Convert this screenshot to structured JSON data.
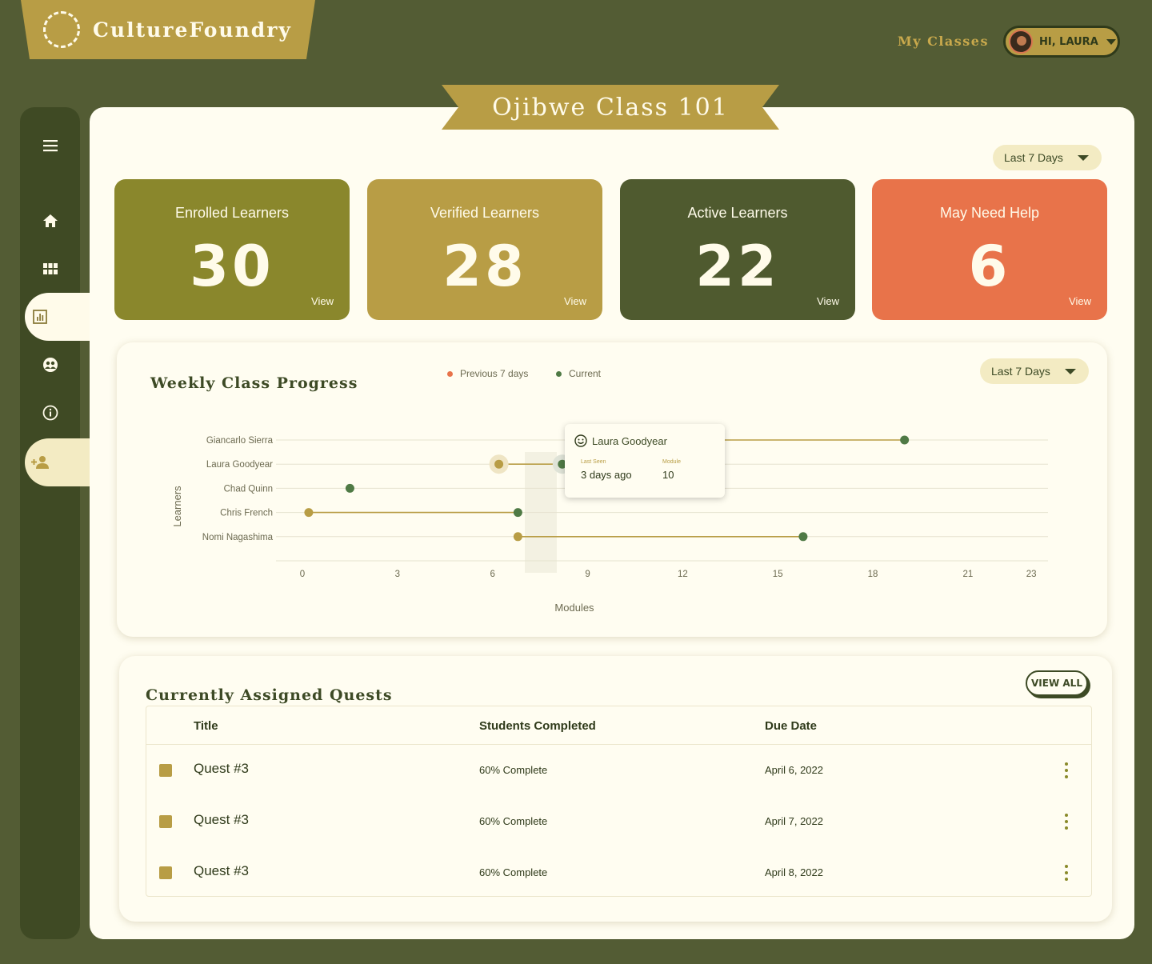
{
  "header": {
    "logo_text": "CultureFoundry",
    "my_classes": "My Classes",
    "user_greeting": "HI, LAURA"
  },
  "page": {
    "class_title": "Ojibwe Class 101",
    "date_filter": "Last 7 Days"
  },
  "sidebar": {
    "items": [
      {
        "name": "menu",
        "icon": "menu-icon"
      },
      {
        "name": "home",
        "icon": "home-icon"
      },
      {
        "name": "dashboard",
        "icon": "grid-icon"
      },
      {
        "name": "analytics",
        "icon": "chart-icon",
        "active": true
      },
      {
        "name": "community",
        "icon": "group-icon"
      },
      {
        "name": "info",
        "icon": "info-icon"
      },
      {
        "name": "add-learner",
        "icon": "add-user-icon"
      }
    ]
  },
  "stats": [
    {
      "label": "Enrolled Learners",
      "value": "30",
      "view": "View",
      "color": "#8a872c"
    },
    {
      "label": "Verified Learners",
      "value": "28",
      "view": "View",
      "color": "#b89d45"
    },
    {
      "label": "Active Learners",
      "value": "22",
      "view": "View",
      "color": "#4f5a2f"
    },
    {
      "label": "May Need Help",
      "value": "6",
      "view": "View",
      "color": "#e8734a"
    }
  ],
  "progress": {
    "title": "Weekly Class Progress",
    "date_filter": "Last 7 Days",
    "legend_previous": "Previous 7 days",
    "legend_current": "Current",
    "tooltip": {
      "name": "Laura Goodyear",
      "last_seen_label": "Last Seen",
      "last_seen_value": "3 days ago",
      "module_label": "Module",
      "module_value": "10"
    }
  },
  "chart_data": {
    "type": "dumbbell",
    "xlabel": "Modules",
    "ylabel": "Learners",
    "xlim": [
      0,
      24
    ],
    "x_ticks": [
      "0",
      "3",
      "6",
      "9",
      "12",
      "15",
      "18",
      "21",
      "23"
    ],
    "categories": [
      "Giancarlo Sierra",
      "Laura Goodyear",
      "Chad Quinn",
      "Chris French",
      "Nomi Nagashima"
    ],
    "series": [
      {
        "name": "Previous 7 days",
        "color": "#b89d45",
        "values": [
          8.5,
          6.2,
          1.5,
          0.2,
          6.8
        ]
      },
      {
        "name": "Current",
        "color": "#4f7a45",
        "values": [
          19,
          8.2,
          1.5,
          6.8,
          15.8
        ]
      }
    ],
    "legend_dot_colors": {
      "previous": "#e8734a",
      "current": "#4f7a45"
    }
  },
  "quests": {
    "title": "Currently Assigned Quests",
    "view_all": "VIEW ALL",
    "columns": [
      "Title",
      "Students Completed",
      "Due Date"
    ],
    "rows": [
      {
        "title": "Quest #3",
        "completed": "60% Complete",
        "due": "April 6, 2022"
      },
      {
        "title": "Quest #3",
        "completed": "60% Complete",
        "due": "April 7, 2022"
      },
      {
        "title": "Quest #3",
        "completed": "60% Complete",
        "due": "April 8, 2022"
      }
    ]
  }
}
